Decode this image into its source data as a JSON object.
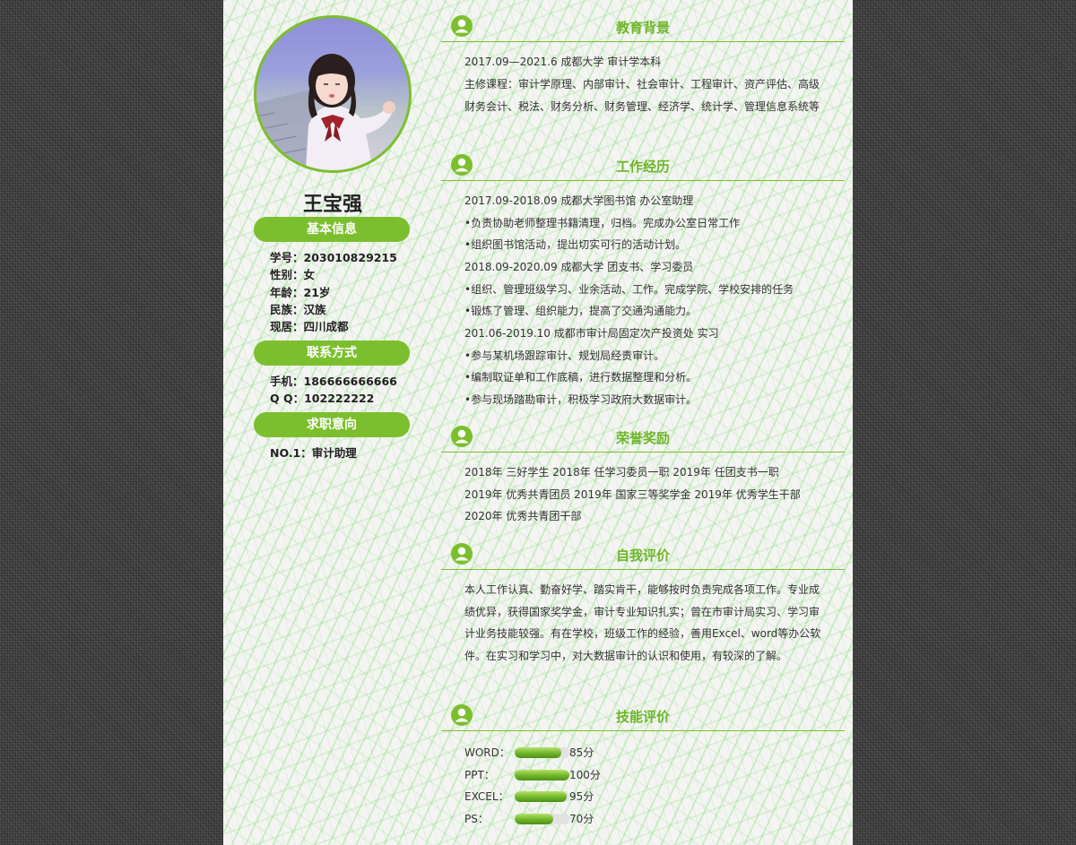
{
  "profile": {
    "name": "王宝强",
    "basic_title": "基本信息",
    "student_id": "学号：203010829215",
    "gender": "性别：女",
    "age": "年龄：21岁",
    "ethnicity": "民族：汉族",
    "residence": "现居：四川成都",
    "contact_title": "联系方式",
    "phone": "手机：186666666666",
    "qq": "Q Q：102222222",
    "intent_title": "求职意向",
    "intent": "NO.1：审计助理"
  },
  "education": {
    "title": "教育背景",
    "lines": [
      "2017.09—2021.6 成都大学 审计学本科"
    ],
    "courses": "主修课程：审计学原理、内部审计、社会审计、工程审计、资产评估、高级财务会计、税法、财务分析、财务管理、经济学、统计学、管理信息系统等"
  },
  "work": {
    "title": "工作经历",
    "lines": [
      "2017.09-2018.09 成都大学图书馆 办公室助理",
      "•负责协助老师整理书籍清理，归档。完成办公室日常工作",
      "•组织图书馆活动，提出切实可行的活动计划。",
      "2018.09-2020.09 成都大学 团支书、学习委员",
      "•组织、管理班级学习、业余活动、工作。完成学院、学校安排的任务",
      "•锻炼了管理、组织能力，提高了交通沟通能力。",
      "201.06-2019.10 成都市审计局固定次产投资处 实习",
      "•参与某机场跟踪审计、规划局经责审计。",
      "•编制取证单和工作底稿，进行数据整理和分析。",
      "•参与现场踏勘审计，积极学习政府大数据审计。"
    ]
  },
  "honors": {
    "title": "荣誉奖励",
    "lines": [
      "2018年 三好学生 2018年 任学习委员一职 2019年 任团支书一职",
      "2019年 优秀共青团员 2019年 国家三等奖学金 2019年 优秀学生干部",
      "2020年 优秀共青团干部"
    ]
  },
  "self_eval": {
    "title": "自我评价",
    "text": "本人工作认真、勤奋好学、踏实肯干，能够按时负责完成各项工作。专业成绩优异，获得国家奖学金，审计专业知识扎实；曾在市审计局实习、学习审计业务技能较强。有在学校，班级工作的经验，善用Excel、word等办公软件。在实习和学习中，对大数据审计的认识和使用，有较深的了解。"
  },
  "skills": {
    "title": "技能评价",
    "items": [
      {
        "label": "WORD：",
        "value": "85分",
        "level": 0.85
      },
      {
        "label": "PPT：",
        "value": "100分",
        "level": 1.0
      },
      {
        "label": "EXCEL：",
        "value": "95分",
        "level": 0.95
      },
      {
        "label": "PS：",
        "value": "70分",
        "level": 0.7
      }
    ]
  },
  "colors": {
    "accent": "#7cbf2e",
    "title_green": "#6db52a"
  },
  "icons": {
    "section": "user-icon"
  }
}
